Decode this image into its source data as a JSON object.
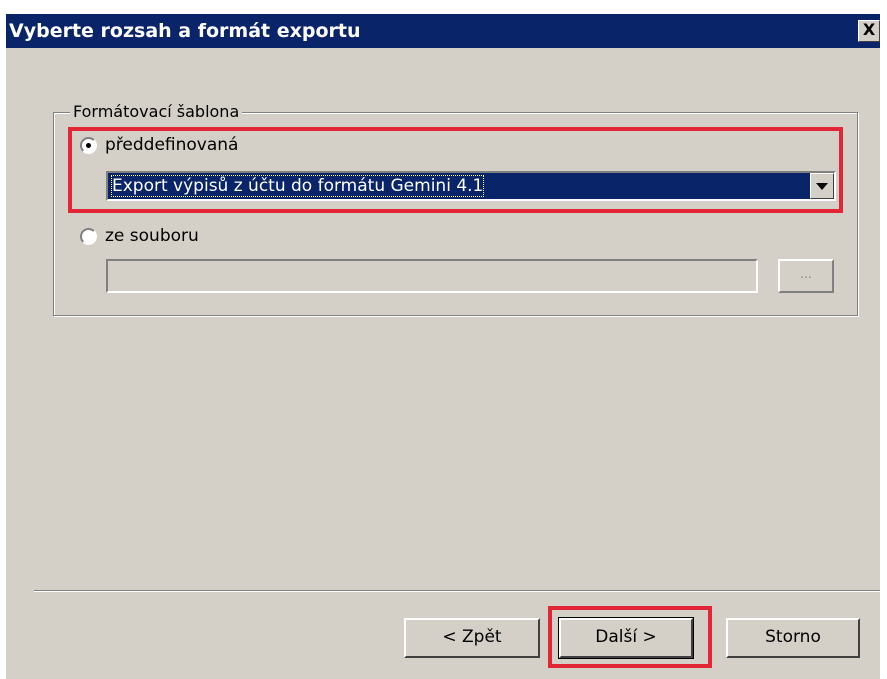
{
  "window": {
    "title": "Vyberte rozsah a formát exportu",
    "close_label": "X"
  },
  "group": {
    "legend": "Formátovací šablona",
    "option_predefined": {
      "label": "předdefinovaná",
      "selected": true,
      "combo_value": "Export výpisů z účtu do formátu Gemini 4.1"
    },
    "option_file": {
      "label": "ze souboru",
      "selected": false,
      "field_value": "",
      "browse_label": "..."
    }
  },
  "buttons": {
    "back_label": "< Zpět",
    "next_label": "Další >",
    "cancel_label": "Storno"
  },
  "colors": {
    "title_bar": "#0a246a",
    "dialog_bg": "#d4d0c8",
    "highlight": "#e32636"
  }
}
